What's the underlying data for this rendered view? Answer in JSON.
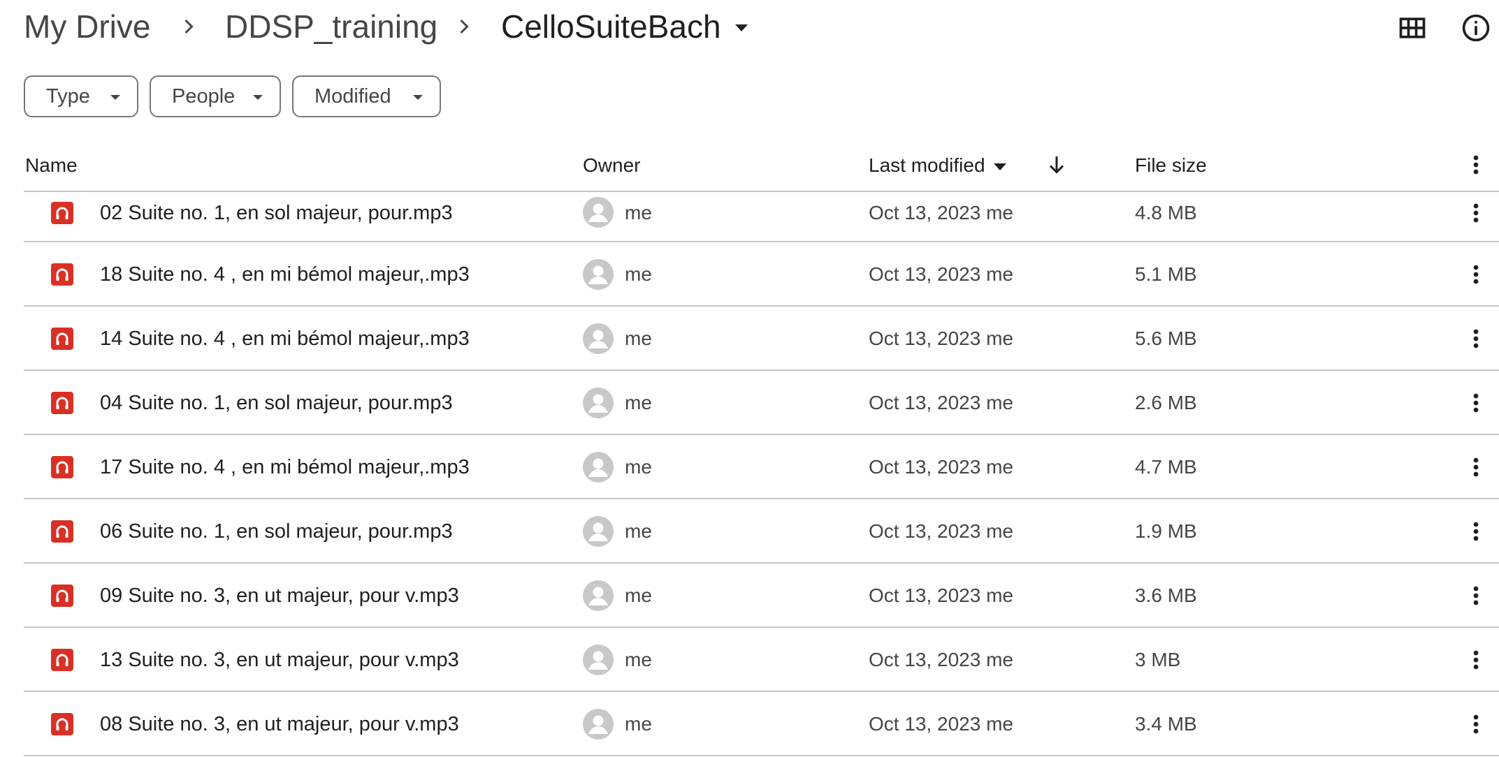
{
  "breadcrumb": {
    "root": "My Drive",
    "parent": "DDSP_training",
    "current": "CelloSuiteBach"
  },
  "header_icons": {
    "grid_view": "grid-view-icon",
    "info": "info-icon"
  },
  "filters": [
    {
      "label": "Type"
    },
    {
      "label": "People"
    },
    {
      "label": "Modified"
    }
  ],
  "columns": {
    "name": "Name",
    "owner": "Owner",
    "last_modified": "Last modified",
    "file_size": "File size"
  },
  "accent_colors": {
    "audio_icon": "#d93025",
    "divider": "#c4c7c5"
  },
  "files": [
    {
      "name": "02 Suite no. 1, en sol majeur, pour.mp3",
      "owner": "me",
      "modified": "Oct 13, 2023 me",
      "size": "4.8 MB"
    },
    {
      "name": "18 Suite no. 4 , en mi bémol majeur,.mp3",
      "owner": "me",
      "modified": "Oct 13, 2023 me",
      "size": "5.1 MB"
    },
    {
      "name": "14 Suite no. 4 , en mi bémol majeur,.mp3",
      "owner": "me",
      "modified": "Oct 13, 2023 me",
      "size": "5.6 MB"
    },
    {
      "name": "04 Suite no. 1, en sol majeur, pour.mp3",
      "owner": "me",
      "modified": "Oct 13, 2023 me",
      "size": "2.6 MB"
    },
    {
      "name": "17 Suite no. 4 , en mi bémol majeur,.mp3",
      "owner": "me",
      "modified": "Oct 13, 2023 me",
      "size": "4.7 MB"
    },
    {
      "name": "06 Suite no. 1, en sol majeur, pour.mp3",
      "owner": "me",
      "modified": "Oct 13, 2023 me",
      "size": "1.9 MB"
    },
    {
      "name": "09 Suite no. 3, en ut majeur, pour v.mp3",
      "owner": "me",
      "modified": "Oct 13, 2023 me",
      "size": "3.6 MB"
    },
    {
      "name": "13 Suite no. 3, en ut majeur, pour v.mp3",
      "owner": "me",
      "modified": "Oct 13, 2023 me",
      "size": "3 MB"
    },
    {
      "name": "08 Suite no. 3, en ut majeur, pour v.mp3",
      "owner": "me",
      "modified": "Oct 13, 2023 me",
      "size": "3.4 MB"
    }
  ]
}
